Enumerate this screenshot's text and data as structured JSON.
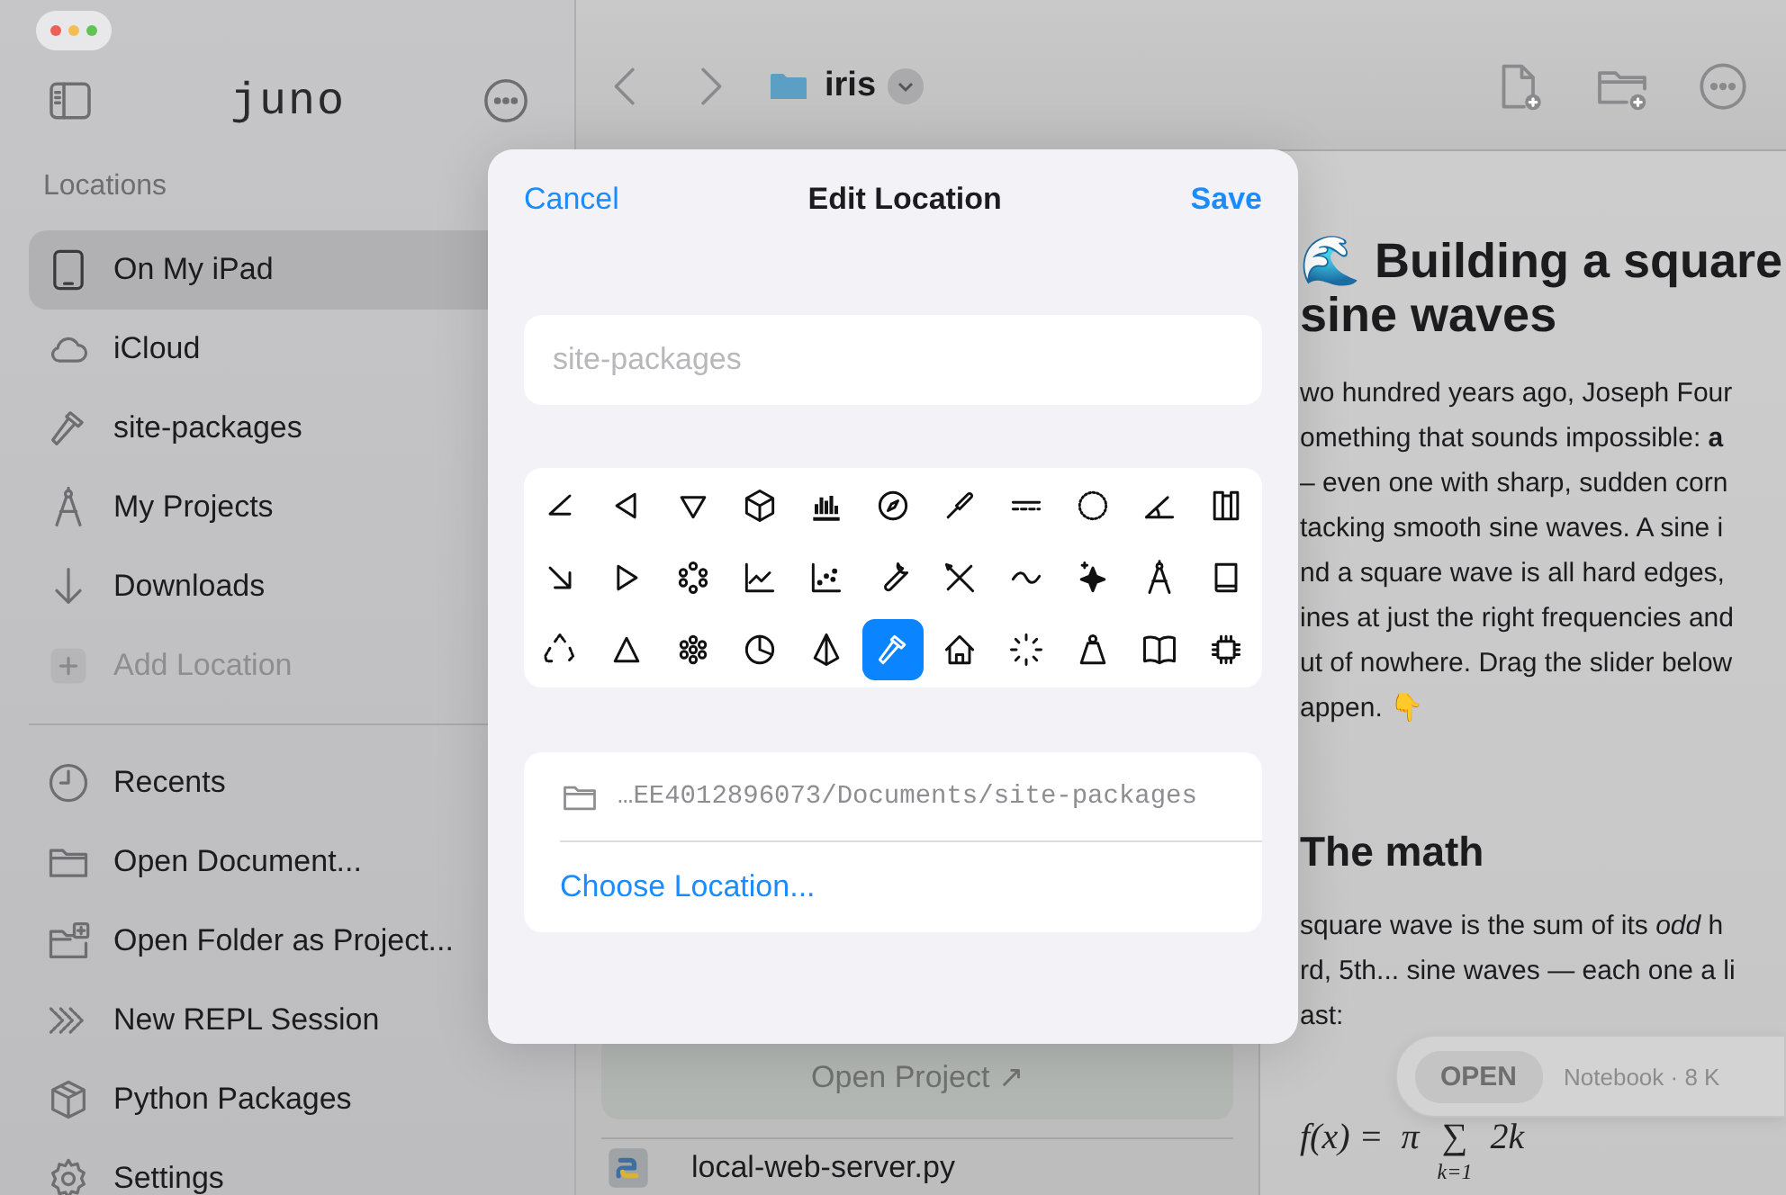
{
  "sidebar": {
    "title": "juno",
    "section_title": "Locations",
    "locations": [
      {
        "label": "On My iPad",
        "selected": true,
        "disabled": false
      },
      {
        "label": "iCloud",
        "selected": false,
        "disabled": false
      },
      {
        "label": "site-packages",
        "selected": false,
        "disabled": false
      },
      {
        "label": "My Projects",
        "selected": false,
        "disabled": false
      },
      {
        "label": "Downloads",
        "selected": false,
        "disabled": false
      },
      {
        "label": "Add Location",
        "selected": false,
        "disabled": true
      }
    ],
    "actions": [
      {
        "label": "Recents"
      },
      {
        "label": "Open Document..."
      },
      {
        "label": "Open Folder as Project..."
      },
      {
        "label": "New REPL Session"
      },
      {
        "label": "Python Packages"
      },
      {
        "label": "Settings"
      }
    ]
  },
  "toolbar": {
    "folder": "iris"
  },
  "middle": {
    "open_button": {
      "label": "Open Project ↗",
      "disabled": true
    },
    "files": [
      {
        "name": "local-web-server.py"
      }
    ]
  },
  "document": {
    "heading_lines": [
      "🌊 Building a square",
      "sine waves"
    ],
    "paragraph_lines": [
      "wo hundred years ago, Joseph Four",
      "omething that sounds impossible: **a**",
      "– even one with sharp, sudden corn",
      "tacking smooth sine waves. A sine i",
      "nd a square wave is all hard edges,",
      "ines at just the right frequencies and",
      "ut of nowhere. Drag the slider below",
      "appen. 👇"
    ],
    "subheading": "The math",
    "paragraph2_lines": [
      "square wave is the sum of its *odd* h",
      "rd, 5th... sine waves — each one a li",
      "ast:"
    ],
    "formula": {
      "lhs": "f(x) =",
      "denominator": "π",
      "sum": "∑",
      "lower_limit": "k=1",
      "term": "2k"
    }
  },
  "floating_bar": {
    "button": "OPEN",
    "info": "Notebook · 8 K"
  },
  "sheet": {
    "cancel": "Cancel",
    "title": "Edit Location",
    "save": "Save",
    "name_field": {
      "placeholder": "site-packages"
    },
    "icons": [
      {
        "selected": false
      },
      {
        "selected": false
      },
      {
        "selected": false
      },
      {
        "selected": false
      },
      {
        "selected": false
      },
      {
        "selected": false
      },
      {
        "selected": false
      },
      {
        "selected": false
      },
      {
        "selected": false
      },
      {
        "selected": false
      },
      {
        "selected": false
      },
      {
        "selected": false
      },
      {
        "selected": false
      },
      {
        "selected": false
      },
      {
        "selected": false
      },
      {
        "selected": false
      },
      {
        "selected": false
      },
      {
        "selected": false
      },
      {
        "selected": false
      },
      {
        "selected": false
      },
      {
        "selected": false
      },
      {
        "selected": false
      },
      {
        "selected": false
      },
      {
        "selected": false
      },
      {
        "selected": false
      },
      {
        "selected": false
      },
      {
        "selected": false
      },
      {
        "selected": true
      },
      {
        "selected": false
      },
      {
        "selected": false
      },
      {
        "selected": false
      },
      {
        "selected": false
      },
      {
        "selected": false
      }
    ],
    "path": "…EE4012896073/Documents/site-packages",
    "choose": "Choose Location..."
  }
}
